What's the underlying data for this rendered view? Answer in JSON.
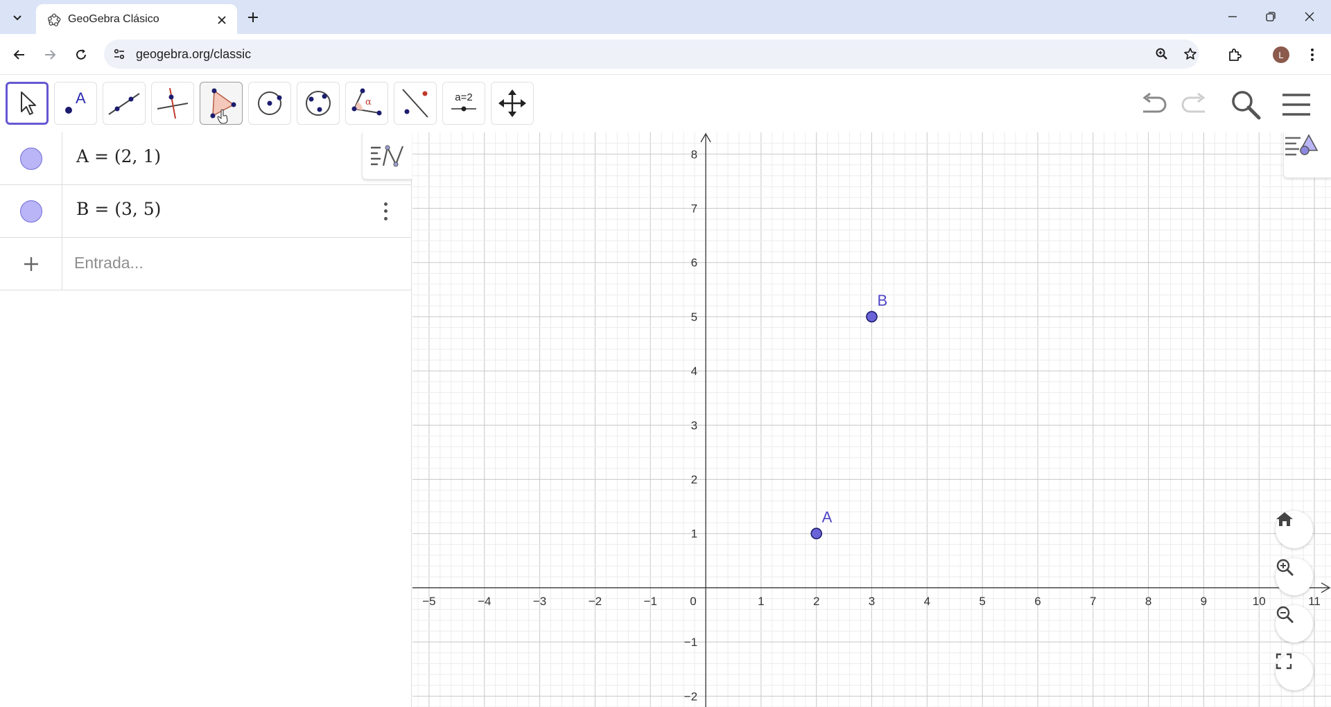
{
  "browser": {
    "tab_title": "GeoGebra Clásico",
    "url": "geogebra.org/classic",
    "profile_initial": "L"
  },
  "toolbar": {
    "tools": [
      {
        "name": "move-tool",
        "icon": "arrow-cursor-icon"
      },
      {
        "name": "point-tool",
        "icon": "point-icon"
      },
      {
        "name": "line-tool",
        "icon": "line-through-two-points-icon"
      },
      {
        "name": "perpendicular-line-tool",
        "icon": "perpendicular-line-icon"
      },
      {
        "name": "polygon-tool",
        "icon": "polygon-icon"
      },
      {
        "name": "circle-center-point-tool",
        "icon": "circle-with-center-icon"
      },
      {
        "name": "circle-three-points-tool",
        "icon": "circle-three-points-icon"
      },
      {
        "name": "angle-tool",
        "icon": "angle-icon"
      },
      {
        "name": "reflect-line-tool",
        "icon": "reflect-about-line-icon"
      },
      {
        "name": "slider-tool",
        "icon": "slider-icon",
        "label": "a=2"
      },
      {
        "name": "move-graphics-view-tool",
        "icon": "move-view-icon"
      }
    ],
    "selected_tool": "move-tool",
    "hovered_tool": "polygon-tool"
  },
  "algebra": {
    "items": [
      {
        "label": "A = (2, 1)",
        "color": "#b9b5f6"
      },
      {
        "label": "B = (3, 5)",
        "color": "#b9b5f6"
      }
    ],
    "input_placeholder": "Entrada..."
  },
  "graphics": {
    "x_range": [
      -5.3,
      11.3
    ],
    "y_range": [
      -2.2,
      8.4
    ],
    "x_ticks": [
      "-5",
      "-4",
      "-3",
      "-2",
      "-1",
      "0",
      "1",
      "2",
      "3",
      "4",
      "5",
      "6",
      "7",
      "8",
      "9",
      "10",
      "11"
    ],
    "y_ticks": [
      "-2",
      "-1",
      "1",
      "2",
      "3",
      "4",
      "5",
      "6",
      "7",
      "8"
    ],
    "points": [
      {
        "name": "A",
        "x": 2,
        "y": 1
      },
      {
        "name": "B",
        "x": 3,
        "y": 5
      }
    ],
    "point_fill": "#6a63d8",
    "point_stroke": "#1c1c6e",
    "label_color": "#4f46c8",
    "grid": true
  }
}
